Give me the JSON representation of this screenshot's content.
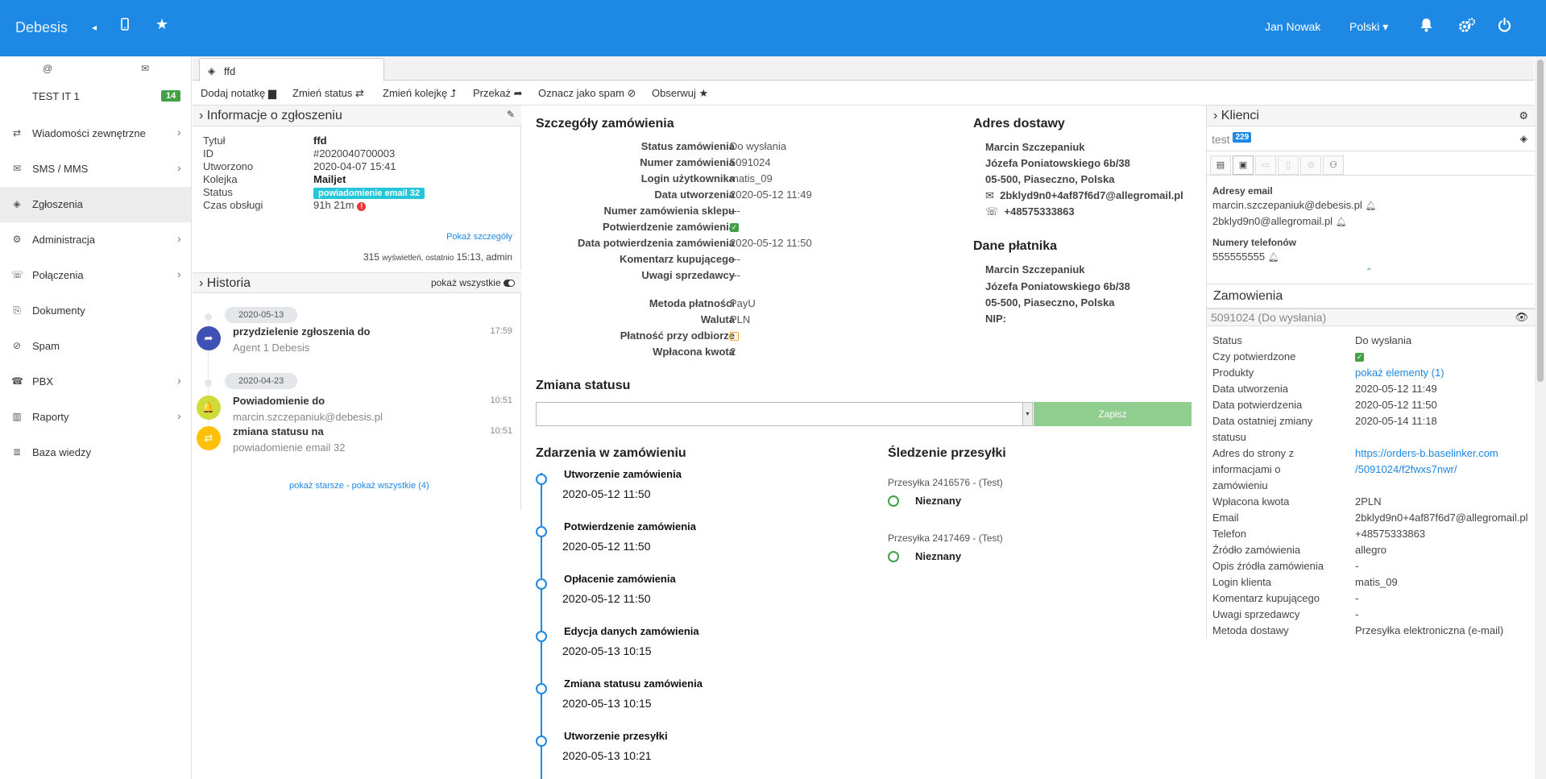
{
  "topbar": {
    "brand": "Debesis",
    "user": "Jan Nowak",
    "language": "Polski",
    "icons": [
      "chevron-left-icon",
      "mobile-icon",
      "star-icon",
      "bell-icon",
      "gears-icon",
      "power-icon"
    ],
    "bg_color": "#1e88e5"
  },
  "sidebar": {
    "top_icons": [
      "@",
      "envelope-icon"
    ],
    "queue": {
      "label": "TEST IT 1",
      "count": "14"
    },
    "items": [
      {
        "label": "Wiadomości zewnętrzne",
        "icon": "⇄",
        "chevron": true
      },
      {
        "label": "SMS / MMS",
        "icon": "✉",
        "chevron": true
      },
      {
        "label": "Zgłoszenia",
        "icon": "◈",
        "chevron": false,
        "active": true
      },
      {
        "label": "Administracja",
        "icon": "⚙",
        "chevron": true
      },
      {
        "label": "Połączenia",
        "icon": "☏",
        "chevron": true
      },
      {
        "label": "Dokumenty",
        "icon": "⎘",
        "chevron": false
      },
      {
        "label": "Spam",
        "icon": "⊘",
        "chevron": false
      },
      {
        "label": "PBX",
        "icon": "☎",
        "chevron": true
      },
      {
        "label": "Raporty",
        "icon": "▥",
        "chevron": true
      },
      {
        "label": "Baza wiedzy",
        "icon": "≣",
        "chevron": false
      }
    ]
  },
  "tab": {
    "label": "ffd"
  },
  "toolbar": {
    "add_note": "Dodaj notatkę",
    "change_status": "Zmień status",
    "change_queue": "Zmień kolejkę",
    "forward": "Przekaż",
    "spam": "Oznacz jako spam",
    "watch": "Obserwuj"
  },
  "ticket_info": {
    "header": "Informacje o zgłoszeniu",
    "rows": [
      {
        "label": "Tytuł",
        "value": "ffd"
      },
      {
        "label": "ID",
        "value": "#2020040700003"
      },
      {
        "label": "Utworzono",
        "value": "2020-04-07 15:41"
      },
      {
        "label": "Kolejka",
        "value": "Mailjet"
      },
      {
        "label": "Status",
        "value": "powiadomienie email 32"
      },
      {
        "label": "Czas obsługi",
        "value": "91h 21m"
      }
    ],
    "show_details": "Pokaż szczegóły",
    "views": "315",
    "views_label": "wyświetleń",
    "last_label": ", ostatnio",
    "last_time": "15:13",
    "last_user": ", admin"
  },
  "history": {
    "header": "Historia",
    "show_all_toggle": "pokaż wszystkie",
    "entries": [
      {
        "date": "2020-05-13"
      },
      {
        "title": "przydzielenie zgłoszenia do",
        "sub": "Agent 1 Debesis",
        "time": "17:59",
        "color": "#3f51b5",
        "icon": "➦"
      },
      {
        "date": "2020-04-23"
      },
      {
        "title": "Powiadomienie do",
        "sub": "marcin.szczepaniuk@debesis.pl",
        "time": "10:51",
        "color": "#cddc39",
        "icon": "🔔"
      },
      {
        "title": "zmiana statusu na",
        "sub": "powiadomienie email 32",
        "time": "10:51",
        "color": "#ffc107",
        "icon": "⇄"
      }
    ],
    "footer": "pokaż starsze - pokaż wszystkie (4)"
  },
  "order": {
    "header": "Szczegóły zamówienia",
    "rows": [
      {
        "label": "Status zamówienia",
        "value": "Do wysłania"
      },
      {
        "label": "Numer zamówienia",
        "value": "5091024"
      },
      {
        "label": "Login użytkownika",
        "value": "matis_09"
      },
      {
        "label": "Data utworzenia",
        "value": "2020-05-12 11:49"
      },
      {
        "label": "Numer zamówienia sklepu",
        "value": "---"
      },
      {
        "label": "Potwierdzenie zamówienia",
        "value": ""
      },
      {
        "label": "Data potwierdzenia zamówienia",
        "value": "2020-05-12 11:50"
      },
      {
        "label": "Komentarz kupującego",
        "value": "---"
      },
      {
        "label": "Uwagi sprzedawcy",
        "value": "---"
      }
    ],
    "pay_rows": [
      {
        "label": "Metoda płatności",
        "value": "PayU"
      },
      {
        "label": "Waluta",
        "value": "PLN"
      },
      {
        "label": "Płatność przy odbiorze",
        "value": ""
      },
      {
        "label": "Wpłacona kwota",
        "value": "2"
      }
    ]
  },
  "delivery": {
    "header": "Adres dostawy",
    "name": "Marcin Szczepaniuk",
    "street": "Józefa Poniatowskiego 6b/38",
    "city": "05-500, Piaseczno, Polska",
    "email": "2bklyd9n0+4af87f6d7@allegromail.pl",
    "phone": "+48575333863"
  },
  "payer": {
    "header": "Dane płatnika",
    "name": "Marcin Szczepaniuk",
    "street": "Józefa Poniatowskiego 6b/38",
    "city": "05-500, Piaseczno, Polska",
    "nip": "NIP:"
  },
  "status_change": {
    "header": "Zmiana statusu",
    "select_value": "",
    "save": "Zapisz"
  },
  "events": {
    "header": "Zdarzenia w zamówieniu",
    "items": [
      {
        "title": "Utworzenie zamówienia",
        "date": "2020-05-12 11:50"
      },
      {
        "title": "Potwierdzenie zamówienia",
        "date": "2020-05-12 11:50"
      },
      {
        "title": "Opłacenie zamówienia",
        "date": "2020-05-12 11:50"
      },
      {
        "title": "Edycja danych zamówienia",
        "date": "2020-05-13 10:15"
      },
      {
        "title": "Zmiana statusu zamówienia",
        "date": "2020-05-13 10:15"
      },
      {
        "title": "Utworzenie przesyłki",
        "date": "2020-05-13 10:21"
      }
    ]
  },
  "tracking": {
    "header": "Śledzenie przesyłki",
    "shipments": [
      {
        "label": "Przesyłka 2416576 - (Test)",
        "status": "Nieznany"
      },
      {
        "label": "Przesyłka 2417469 - (Test)",
        "status": "Nieznany"
      }
    ]
  },
  "clients": {
    "header": "Klienci",
    "name": "test",
    "count": "229",
    "emails_header": "Adresy email",
    "emails": [
      "marcin.szczepaniuk@debesis.pl",
      "2bklyd9n0@allegromail.pl"
    ],
    "phones_header": "Numery telefonów",
    "phones": [
      "555555555"
    ]
  },
  "orders": {
    "header": "Zamowienia",
    "title": "5091024 (Do wysłania)",
    "rows": [
      {
        "label": "Status",
        "value": "Do wysłania"
      },
      {
        "label": "Czy potwierdzone",
        "value": ""
      },
      {
        "label": "Produkty",
        "value": "pokaż elementy (1)"
      },
      {
        "label": "Data utworzenia",
        "value": "2020-05-12 11:49"
      },
      {
        "label": "Data potwierdzenia",
        "value": "2020-05-12 11:50"
      },
      {
        "label": "Data ostatniej zmiany",
        "label2": "statusu",
        "value": "2020-05-14 11:18"
      },
      {
        "label": "Adres do strony z",
        "label2": "informacjami o",
        "label3": "zamówieniu",
        "value": "https://orders-b.baselinker.com",
        "value2": "/5091024/f2fwxs7nwr/"
      },
      {
        "label": "Wpłacona kwota",
        "value": "2PLN"
      },
      {
        "label": "Email",
        "value": "2bklyd9n0+4af87f6d7@allegromail.pl"
      },
      {
        "label": "Telefon",
        "value": "+48575333863"
      },
      {
        "label": "Źródło zamówienia",
        "value": "allegro"
      },
      {
        "label": "Opis źródła zamówienia",
        "value": "-"
      },
      {
        "label": "Login klienta",
        "value": "matis_09"
      },
      {
        "label": "Komentarz kupującego",
        "value": "-"
      },
      {
        "label": "Uwagi sprzedawcy",
        "value": "-"
      },
      {
        "label": "Metoda dostawy",
        "value": "Przesyłka elektroniczna (e-mail)"
      }
    ]
  }
}
